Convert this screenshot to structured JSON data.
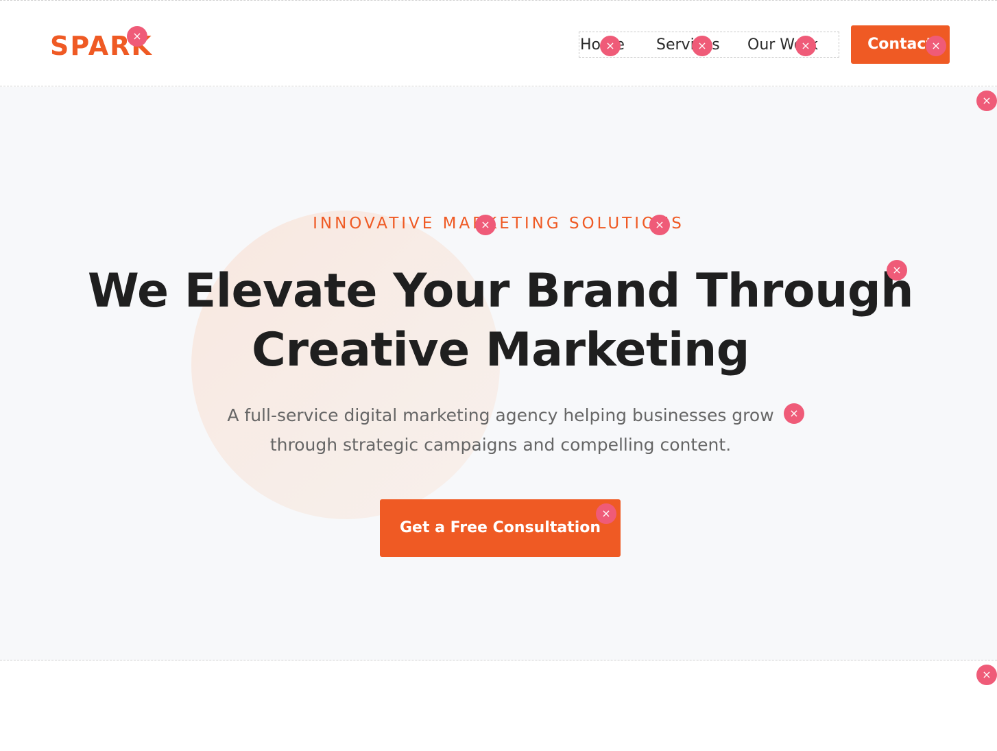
{
  "header": {
    "logo": "SPARK",
    "nav": [
      {
        "label": "Home"
      },
      {
        "label": "Services"
      },
      {
        "label": "Our Work"
      }
    ],
    "contact_label": "Contact"
  },
  "hero": {
    "eyebrow": "INNOVATIVE MARKETING SOLUTIONS",
    "headline": "We Elevate Your Brand Through Creative Marketing",
    "subtext": "A full-service digital marketing agency helping businesses grow through strategic campaigns and compelling content.",
    "cta_label": "Get a Free Consultation"
  },
  "overlay": {
    "remove_glyph": "×"
  },
  "colors": {
    "accent": "#ef5a24",
    "remove_badge": "#ef5b78",
    "hero_background": "#f7f8fa",
    "heading": "#1f1f1f",
    "body_text": "#666666"
  }
}
